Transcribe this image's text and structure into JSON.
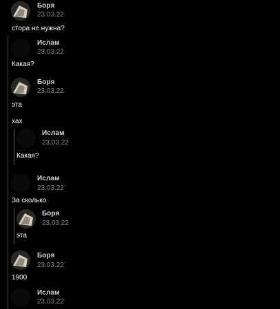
{
  "messages": [
    {
      "author": "Боря",
      "date": "23.03.22",
      "text": "стора не нужна?"
    },
    {
      "author": "Ислам",
      "date": "23.03.22",
      "text": "Какая?"
    },
    {
      "author": "Боря",
      "date": "23.03.22",
      "text": "эта",
      "text2": "хах"
    },
    {
      "quoted": {
        "author": "Ислам",
        "date": "23.03.22",
        "text": "Какая?"
      }
    },
    {
      "author": "Ислам",
      "date": "23.03.22",
      "text": "За сколько"
    },
    {
      "quoted": {
        "author": "Боря",
        "date": "23.03.22",
        "text": "эта"
      }
    },
    {
      "author": "Боря",
      "date": "23.03.22",
      "text": "1900"
    },
    {
      "author": "Ислам",
      "date": "23.03.22"
    }
  ]
}
